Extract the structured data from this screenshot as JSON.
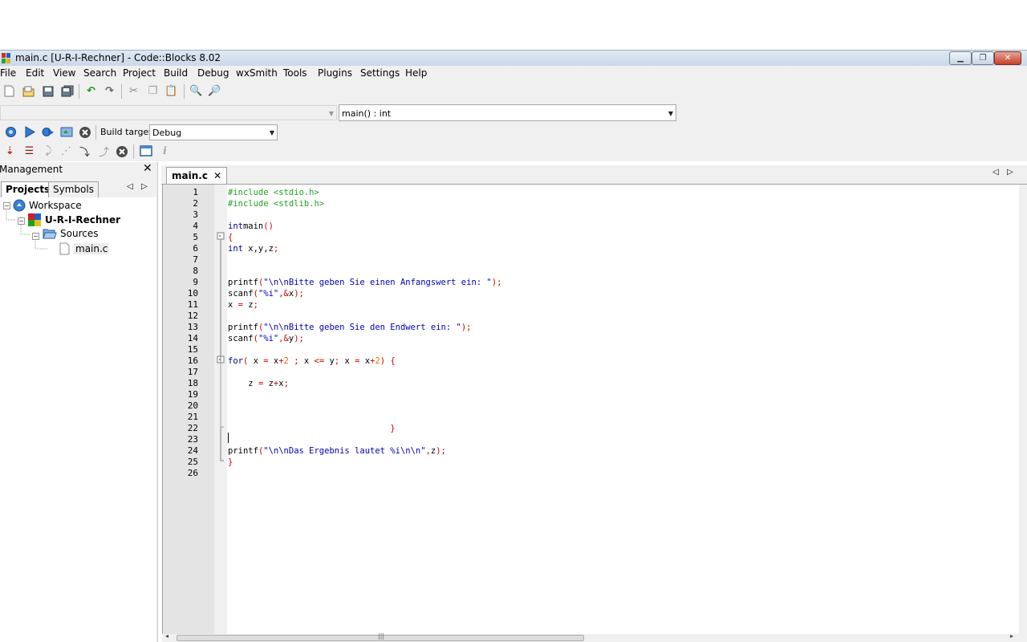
{
  "window": {
    "title": "main.c [U-R-I-Rechner] - Code::Blocks 8.02"
  },
  "menu": [
    "File",
    "Edit",
    "View",
    "Search",
    "Project",
    "Build",
    "Debug",
    "wxSmith",
    "Tools",
    "Plugins",
    "Settings",
    "Help"
  ],
  "toolbar2": {
    "scope_combo": "",
    "function_combo": "main() : int"
  },
  "toolbar3": {
    "build_target_label": "Build target:",
    "build_target_value": "Debug"
  },
  "management": {
    "title": "Management",
    "tabs": [
      "Projects",
      "Symbols"
    ],
    "tree": {
      "workspace": "Workspace",
      "project": "U-R-I-Rechner",
      "folder": "Sources",
      "file": "main.c"
    }
  },
  "editor": {
    "tab_label": "main.c",
    "lines": [
      {
        "n": "1",
        "s": [
          [
            "pp",
            "#include <stdio.h>"
          ]
        ]
      },
      {
        "n": "2",
        "s": [
          [
            "pp",
            "#include <stdlib.h>"
          ]
        ]
      },
      {
        "n": "3",
        "s": []
      },
      {
        "n": "4",
        "s": [
          [
            "kw",
            "int"
          ],
          [
            "",
            "main"
          ],
          [
            "op",
            "()"
          ]
        ]
      },
      {
        "n": "5",
        "s": [
          [
            "op",
            "{"
          ]
        ]
      },
      {
        "n": "6",
        "s": [
          [
            "kw",
            "int"
          ],
          [
            "",
            " x,y,z"
          ],
          [
            "op",
            ";"
          ]
        ]
      },
      {
        "n": "7",
        "s": []
      },
      {
        "n": "8",
        "s": []
      },
      {
        "n": "9",
        "s": [
          [
            "",
            "printf"
          ],
          [
            "op",
            "("
          ],
          [
            "str",
            "\"\\n\\nBitte geben Sie einen Anfangswert ein: \""
          ],
          [
            "op",
            ");"
          ]
        ]
      },
      {
        "n": "10",
        "s": [
          [
            "",
            "scanf"
          ],
          [
            "op",
            "("
          ],
          [
            "str",
            "\"%i\""
          ],
          [
            "op",
            ",&"
          ],
          [
            "",
            "x"
          ],
          [
            "op",
            ");"
          ]
        ]
      },
      {
        "n": "11",
        "s": [
          [
            "",
            "x "
          ],
          [
            "op",
            "="
          ],
          [
            "",
            " z"
          ],
          [
            "op",
            ";"
          ]
        ]
      },
      {
        "n": "12",
        "s": []
      },
      {
        "n": "13",
        "s": [
          [
            "",
            "printf"
          ],
          [
            "op",
            "("
          ],
          [
            "str",
            "\"\\n\\nBitte geben Sie den Endwert ein: \""
          ],
          [
            "op",
            ");"
          ]
        ]
      },
      {
        "n": "14",
        "s": [
          [
            "",
            "scanf"
          ],
          [
            "op",
            "("
          ],
          [
            "str",
            "\"%i\""
          ],
          [
            "op",
            ",&"
          ],
          [
            "",
            "y"
          ],
          [
            "op",
            ");"
          ]
        ]
      },
      {
        "n": "15",
        "s": []
      },
      {
        "n": "16",
        "s": [
          [
            "kw",
            "for"
          ],
          [
            "op",
            "("
          ],
          [
            "",
            " x "
          ],
          [
            "op",
            "="
          ],
          [
            "",
            " x"
          ],
          [
            "op",
            "+"
          ],
          [
            "num",
            "2"
          ],
          [
            "op",
            " ;"
          ],
          [
            "",
            " x "
          ],
          [
            "op",
            "<="
          ],
          [
            "",
            " y"
          ],
          [
            "op",
            ";"
          ],
          [
            "",
            " x "
          ],
          [
            "op",
            "="
          ],
          [
            "",
            " x"
          ],
          [
            "op",
            "+"
          ],
          [
            "num",
            "2"
          ],
          [
            "op",
            ")"
          ],
          [
            "",
            " "
          ],
          [
            "op",
            "{"
          ]
        ]
      },
      {
        "n": "17",
        "s": []
      },
      {
        "n": "18",
        "s": [
          [
            "",
            "    z "
          ],
          [
            "op",
            "="
          ],
          [
            "",
            " z"
          ],
          [
            "op",
            "+"
          ],
          [
            "",
            "x"
          ],
          [
            "op",
            ";"
          ]
        ]
      },
      {
        "n": "19",
        "s": []
      },
      {
        "n": "20",
        "s": []
      },
      {
        "n": "21",
        "s": []
      },
      {
        "n": "22",
        "s": [
          [
            "",
            "                                "
          ],
          [
            "op",
            "}"
          ]
        ]
      },
      {
        "n": "23",
        "s": []
      },
      {
        "n": "24",
        "s": [
          [
            "",
            "printf"
          ],
          [
            "op",
            "("
          ],
          [
            "str",
            "\"\\n\\nDas Ergebnis lautet %i\\n\\n\""
          ],
          [
            "op",
            ","
          ],
          [
            "",
            "z"
          ],
          [
            "op",
            ");"
          ]
        ]
      },
      {
        "n": "25",
        "s": [
          [
            "op",
            "}"
          ]
        ]
      },
      {
        "n": "26",
        "s": []
      }
    ]
  },
  "icons": {
    "close": "✕",
    "left": "◁",
    "right": "▷",
    "dropdown": "▼"
  }
}
